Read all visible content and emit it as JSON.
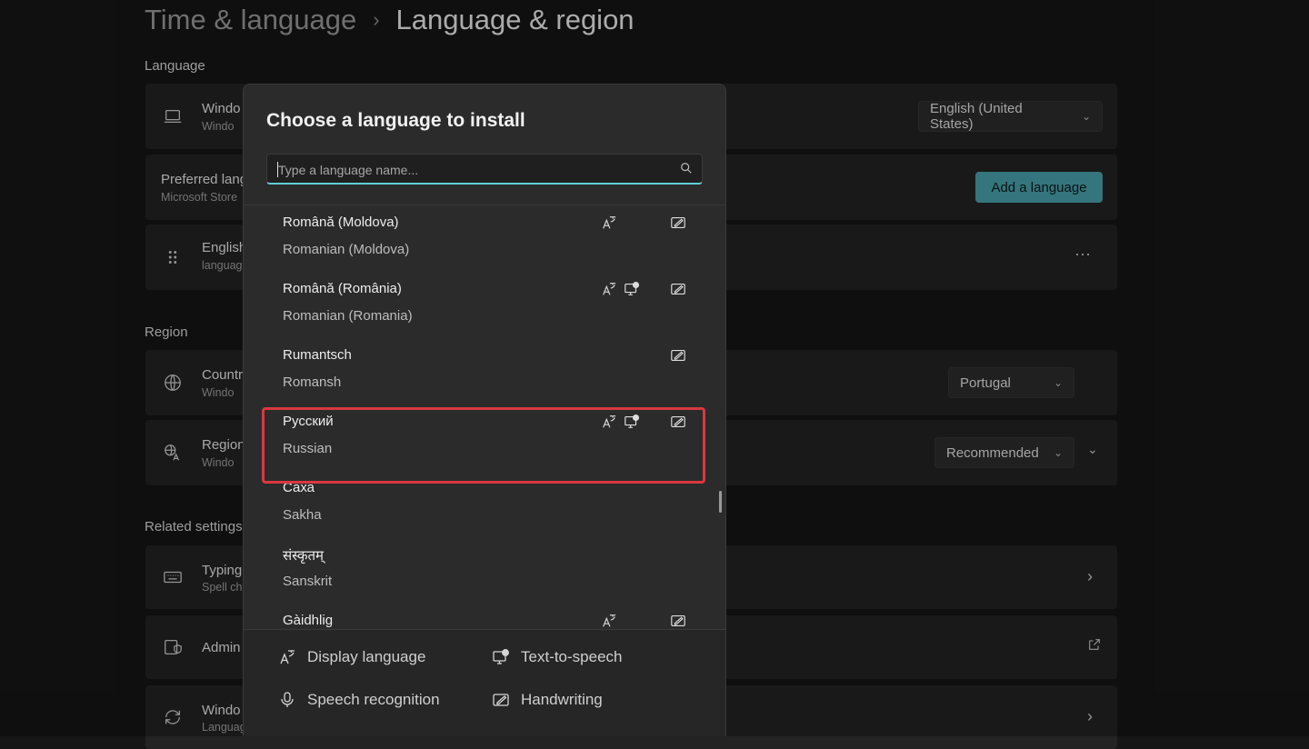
{
  "breadcrumb": {
    "parent": "Time & language",
    "separator": "›",
    "current": "Language & region"
  },
  "language_section": {
    "label": "Language",
    "windows_display": {
      "title": "Windo",
      "subtitle": "Windo",
      "value": "English (United States)"
    },
    "preferred": {
      "title": "Preferred lang",
      "subtitle": "Microsoft Store",
      "button": "Add a language"
    },
    "english_item": {
      "title": "English",
      "subtitle": "languag",
      "more": "···"
    }
  },
  "region_section": {
    "label": "Region",
    "country": {
      "title": "Countr",
      "subtitle": "Windo",
      "value": "Portugal"
    },
    "regional_format": {
      "title": "Region",
      "subtitle": "Windo",
      "value": "Recommended"
    }
  },
  "related_section": {
    "label": "Related settings",
    "typing": {
      "title": "Typing",
      "subtitle": "Spell ch"
    },
    "admin": {
      "title": "Admin"
    },
    "windows_backup": {
      "title": "Windo",
      "subtitle": "Languag"
    }
  },
  "dialog": {
    "title": "Choose a language to install",
    "search_placeholder": "Type a language name...",
    "languages": [
      {
        "native": "Română (Moldova)",
        "english": "Romanian (Moldova)",
        "display": true,
        "tts": false,
        "handwriting": true
      },
      {
        "native": "Română (România)",
        "english": "Romanian (Romania)",
        "display": true,
        "tts": true,
        "handwriting": true
      },
      {
        "native": "Rumantsch",
        "english": "Romansh",
        "display": false,
        "tts": false,
        "handwriting": true
      },
      {
        "native": "Русский",
        "english": "Russian",
        "display": true,
        "tts": true,
        "handwriting": true,
        "highlighted": true
      },
      {
        "native": "Саха",
        "english": "Sakha",
        "display": false,
        "tts": false,
        "handwriting": false
      },
      {
        "native": "संस्कृतम्",
        "english": "Sanskrit",
        "display": false,
        "tts": false,
        "handwriting": false
      },
      {
        "native": "Gàidhlig",
        "english": "",
        "display": true,
        "tts": false,
        "handwriting": true
      }
    ],
    "legend": {
      "display_language": "Display language",
      "text_to_speech": "Text-to-speech",
      "speech_recognition": "Speech recognition",
      "handwriting": "Handwriting"
    }
  },
  "colors": {
    "accent": "#4aa3ad",
    "highlight": "#d9383f",
    "search_underline": "#60cdd8"
  }
}
